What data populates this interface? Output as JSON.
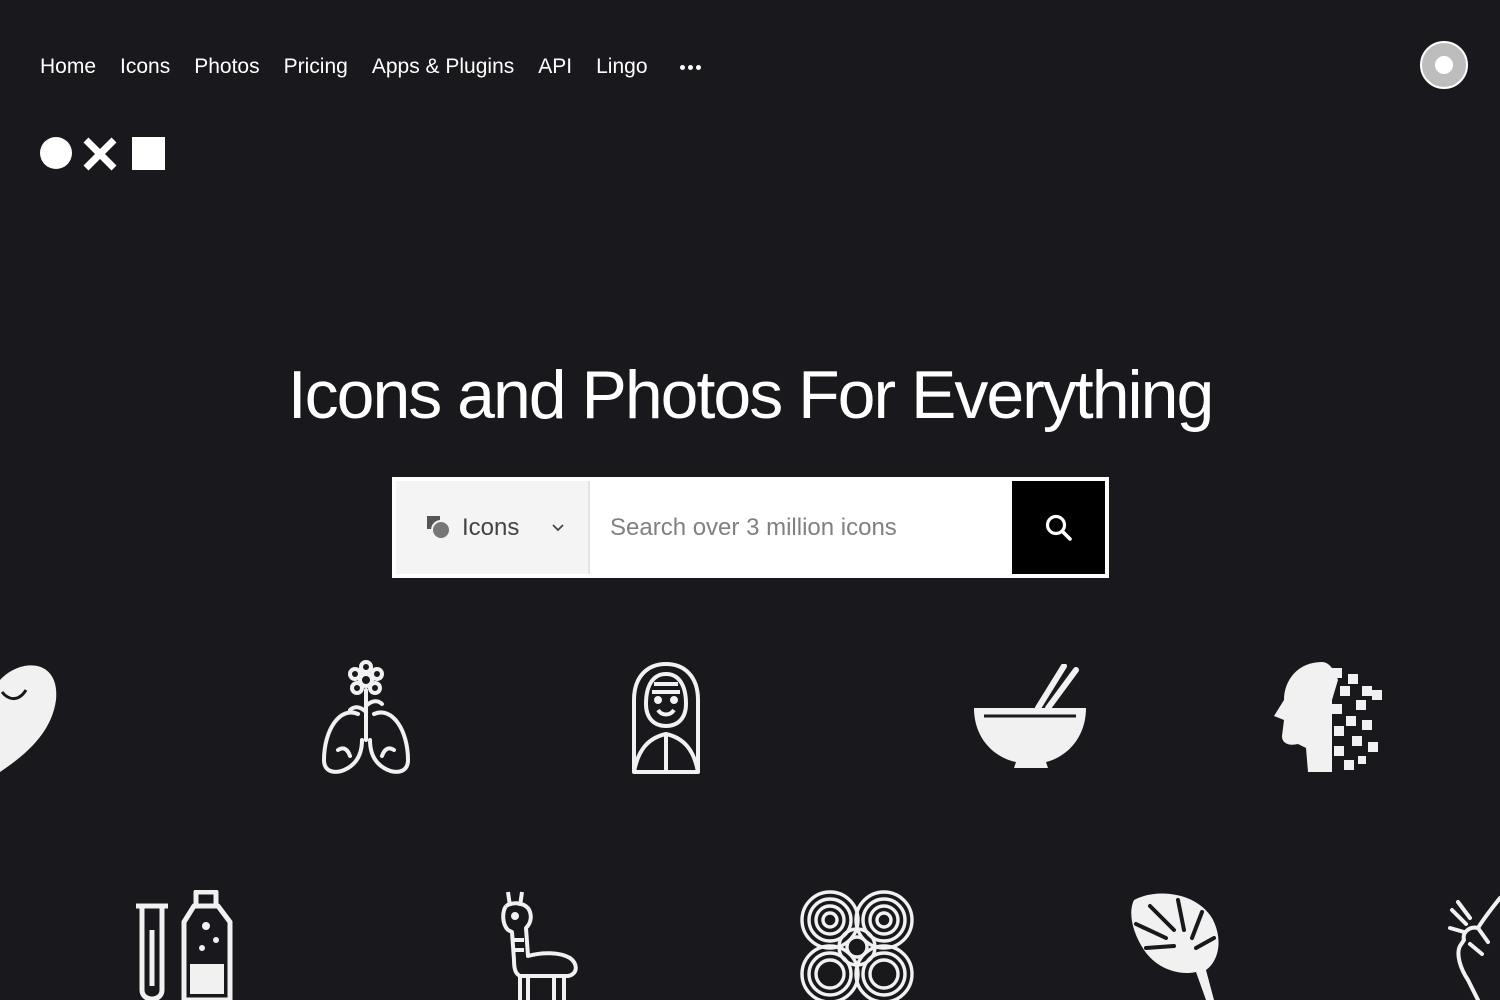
{
  "nav": {
    "items": [
      {
        "label": "Home"
      },
      {
        "label": "Icons"
      },
      {
        "label": "Photos"
      },
      {
        "label": "Pricing"
      },
      {
        "label": "Apps & Plugins"
      },
      {
        "label": "API"
      },
      {
        "label": "Lingo"
      }
    ],
    "more_icon": "more-dots-icon"
  },
  "account": {
    "avatar_icon": "user-avatar-icon"
  },
  "brand": {
    "logo_icon": "circle-x-square-logo"
  },
  "hero": {
    "title": "Icons and Photos For Everything"
  },
  "search": {
    "type_label": "Icons",
    "placeholder": "Search over 3 million icons",
    "value": ""
  },
  "showcase_icons": [
    "sauce-drip-icon",
    "lungs-flower-icon",
    "woman-veil-icon",
    "bowl-chopsticks-icon",
    "pixel-head-icon",
    "test-tube-bottle-icon",
    "llama-icon",
    "swirl-pattern-icon",
    "monstera-leaf-icon",
    "clapping-hand-icon"
  ],
  "colors": {
    "background": "#18181d",
    "text": "#ffffff",
    "search_button": "#000000",
    "icon_fill": "#f1f1f1"
  }
}
